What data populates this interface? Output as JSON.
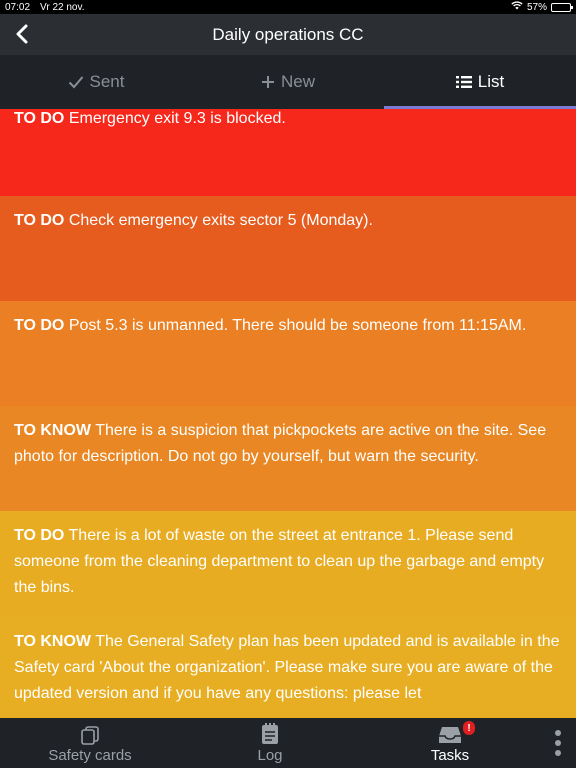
{
  "status": {
    "time": "07:02",
    "date": "Vr 22 nov.",
    "battery": "57%",
    "battery_level": 0.57
  },
  "header": {
    "title": "Daily operations CC"
  },
  "tabs": [
    {
      "label": "Sent",
      "icon": "check-icon"
    },
    {
      "label": "New",
      "icon": "plus-icon"
    },
    {
      "label": "List",
      "icon": "list-icon"
    }
  ],
  "items": [
    {
      "tag": "TO DO",
      "text": "Emergency exit 9.3 is blocked.",
      "color": "#f6271b"
    },
    {
      "tag": "TO DO",
      "text": "Check emergency exits sector 5 (Monday).",
      "color": "#e65c1e"
    },
    {
      "tag": "TO DO",
      "text": "Post 5.3 is unmanned. There should be someone from 11:15AM.",
      "color": "#ea8023"
    },
    {
      "tag": "TO KNOW",
      "text": "There is a suspicion that pickpockets are active on the site. See photo for description. Do not go by yourself, but warn the security.",
      "color": "#e88723"
    },
    {
      "tag": "TO DO",
      "text": "There is a lot of waste on the street at entrance 1. Please send someone from the cleaning department to clean up the garbage and empty the bins.",
      "color": "#e8ac23"
    },
    {
      "tag": "TO KNOW",
      "text": "The General Safety plan has been updated and is available in the Safety card 'About the organization'. Please make sure you are aware of the updated version and if you have any questions: please let",
      "color": "#e8ae23"
    }
  ],
  "bottom_tabs": [
    {
      "label": "Safety cards",
      "icon": "safety-cards-icon"
    },
    {
      "label": "Log",
      "icon": "log-icon"
    },
    {
      "label": "Tasks",
      "icon": "tasks-inbox-icon",
      "badge": "!"
    }
  ]
}
